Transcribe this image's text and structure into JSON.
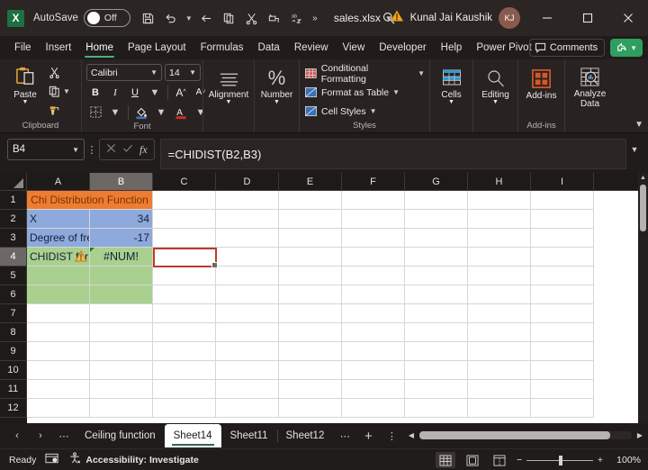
{
  "titlebar": {
    "app_logo": "excel-logo",
    "autosave_label": "AutoSave",
    "autosave_state": "Off",
    "quick_access": [
      {
        "name": "save-icon",
        "label": "Save"
      },
      {
        "name": "undo-icon",
        "label": "Undo"
      },
      {
        "name": "undo-dropdown-icon",
        "label": "Undo options"
      },
      {
        "name": "redo-icon",
        "label": "Redo"
      },
      {
        "name": "copy-icon",
        "label": "Copy"
      },
      {
        "name": "cut-icon",
        "label": "Cut"
      },
      {
        "name": "format-painter-icon",
        "label": "Format Painter"
      },
      {
        "name": "spelling-icon",
        "label": "Spelling"
      },
      {
        "name": "more-commands-icon",
        "label": "More"
      }
    ],
    "filename": "sales.xlsx",
    "search_icon": "search-icon",
    "warning_icon": "warning-icon",
    "user_name": "Kunal Jai Kaushik",
    "user_initials": "KJ",
    "window_minimize": "minimize-icon",
    "window_maximize": "maximize-icon",
    "window_close": "close-icon"
  },
  "ribbon_tabs": {
    "items": [
      "File",
      "Insert",
      "Home",
      "Page Layout",
      "Formulas",
      "Data",
      "Review",
      "View",
      "Developer",
      "Help",
      "Power Pivot"
    ],
    "active": "Home",
    "comments_label": "Comments",
    "share_label": "Share"
  },
  "ribbon": {
    "clipboard": {
      "title": "Clipboard",
      "paste_label": "Paste",
      "cut_label": "Cut",
      "copy_label": "Copy",
      "format_painter_label": "Format Painter"
    },
    "font": {
      "title": "Font",
      "font_name": "Calibri",
      "font_size": "14",
      "bold": "B",
      "italic": "I",
      "underline": "U",
      "grow_font": "A",
      "shrink_font": "A",
      "borders_label": "Borders",
      "fill_color_label": "Fill Color",
      "font_color_label": "Font Color"
    },
    "alignment": {
      "title": "Alignment",
      "label": "Alignment"
    },
    "number": {
      "title": "Number",
      "label": "Number",
      "symbol": "%"
    },
    "styles": {
      "title": "Styles",
      "conditional_formatting": "Conditional Formatting",
      "format_as_table": "Format as Table",
      "cell_styles": "Cell Styles"
    },
    "cells": {
      "label": "Cells"
    },
    "editing": {
      "label": "Editing"
    },
    "addins": {
      "title": "Add-ins",
      "label": "Add-ins"
    },
    "analyze": {
      "label_line1": "Analyze",
      "label_line2": "Data"
    }
  },
  "formula_bar": {
    "name_box": "B4",
    "cancel_icon": "cancel-icon",
    "enter_icon": "confirm-icon",
    "fx_icon": "fx-icon",
    "formula": "=CHIDIST(B2,B3)",
    "expand_icon": "chevron-down-icon"
  },
  "grid": {
    "columns": [
      "A",
      "B",
      "C",
      "D",
      "E",
      "F",
      "G",
      "H",
      "I"
    ],
    "selected_column": "B",
    "rows": [
      "1",
      "2",
      "3",
      "4",
      "5",
      "6",
      "7",
      "8",
      "9",
      "10",
      "11",
      "12"
    ],
    "selected_row": "4",
    "cells": {
      "a1_merged": "Chi Distribution Function",
      "a2": "X",
      "b2": "34",
      "a3": "Degree of freedom",
      "b3": "-17",
      "a4": "CHIDIST formul",
      "b4": "#NUM!",
      "warning_icon": "warning-triangle-icon"
    },
    "colors": {
      "header_fill": "#ED7D31",
      "header_text": "#843C0C",
      "data_fill": "#8EA9DB",
      "result_fill": "#A9D08E",
      "selection_border": "#C0392B"
    }
  },
  "sheet_tabs": {
    "prev_icon": "chevron-left-icon",
    "next_icon": "chevron-right-icon",
    "overflow_left_icon": "ellipsis-icon",
    "items": [
      "Ceiling function",
      "Sheet14",
      "Sheet11",
      "Sheet12"
    ],
    "active": "Sheet14",
    "overflow_right_icon": "ellipsis-icon",
    "add_sheet_icon": "plus-icon",
    "sheet_menu_icon": "vertical-ellipsis-icon"
  },
  "status_bar": {
    "status": "Ready",
    "macro_icon": "record-macro-icon",
    "accessibility_icon": "accessibility-icon",
    "accessibility_text": "Accessibility: Investigate",
    "view_normal_icon": "normal-view-icon",
    "view_pagelayout_icon": "page-layout-view-icon",
    "view_pagebreak_icon": "page-break-view-icon",
    "zoom_out": "−",
    "zoom_in": "+",
    "zoom_level": "100%"
  }
}
